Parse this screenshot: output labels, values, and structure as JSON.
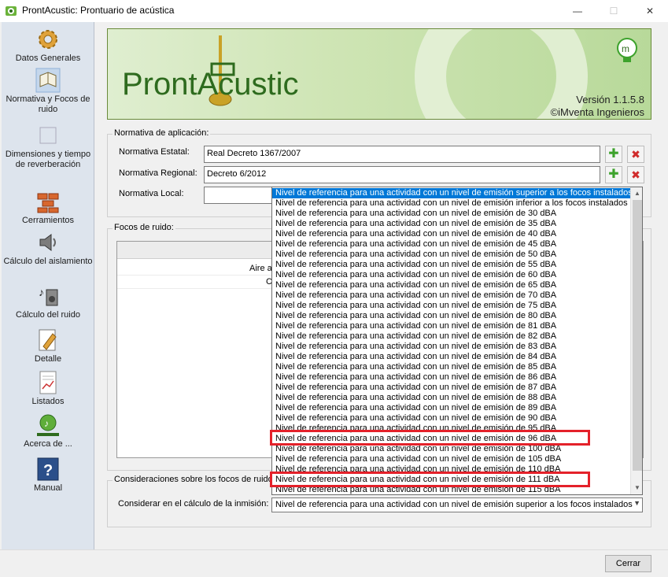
{
  "window": {
    "title": "ProntAcustic: Prontuario de acústica",
    "min_glyph": "—",
    "max_glyph": "☐",
    "close_glyph": "✕"
  },
  "sidebar": {
    "items": [
      {
        "label": "Datos Generales",
        "icon": "gear-icon"
      },
      {
        "label": "Normativa y Focos de ruido",
        "icon": "book-icon",
        "active": true
      },
      {
        "label": "Dimensiones y tiempo de reverberación",
        "icon": "dimensions-icon"
      },
      {
        "label": "Cerramientos",
        "icon": "bricks-icon"
      },
      {
        "label": "Cálculo del aislamiento",
        "icon": "speaker-off-icon"
      },
      {
        "label": "Cálculo del ruido",
        "icon": "music-speaker-icon"
      },
      {
        "label": "Detalle",
        "icon": "detail-icon"
      },
      {
        "label": "Listados",
        "icon": "list-icon"
      },
      {
        "label": "Acerca de ...",
        "icon": "about-icon"
      },
      {
        "label": "Manual",
        "icon": "help-icon"
      }
    ]
  },
  "banner": {
    "title": "ProntAcustic",
    "version": "Versión 1.1.5.8",
    "company": "©iMventa Ingenieros"
  },
  "normativa": {
    "group_title": "Normativa de aplicación:",
    "estatal_label": "Normativa Estatal:",
    "estatal_value": "Real Decreto 1367/2007",
    "regional_label": "Normativa Regional:",
    "regional_value": "Decreto 6/2012",
    "local_label": "Normativa Local:",
    "add_glyph": "✚",
    "delete_glyph": "✖"
  },
  "focos": {
    "group_title": "Focos de ruido:",
    "rows": [
      "Aire ac",
      "C"
    ]
  },
  "dropdown": {
    "items": [
      "Nivel de referencia para una actividad con un nivel de emisión superior a los focos instalados",
      "Nivel de referencia para una actividad con un nivel de emisión inferior a los focos instalados",
      "Nivel de referencia para una actividad con un nivel de emisión de 30 dBA",
      "Nivel de referencia para una actividad con un nivel de emisión de 35 dBA",
      "Nivel de referencia para una actividad con un nivel de emisión de 40 dBA",
      "Nivel de referencia para una actividad con un nivel de emisión de 45 dBA",
      "Nivel de referencia para una actividad con un nivel de emisión de 50 dBA",
      "Nivel de referencia para una actividad con un nivel de emisión de 55 dBA",
      "Nivel de referencia para una actividad con un nivel de emisión de 60 dBA",
      "Nivel de referencia para una actividad con un nivel de emisión de 65 dBA",
      "Nivel de referencia para una actividad con un nivel de emisión de 70 dBA",
      "Nivel de referencia para una actividad con un nivel de emisión de 75 dBA",
      "Nivel de referencia para una actividad con un nivel de emisión de 80 dBA",
      "Nivel de referencia para una actividad con un nivel de emisión de 81 dBA",
      "Nivel de referencia para una actividad con un nivel de emisión de 82 dBA",
      "Nivel de referencia para una actividad con un nivel de emisión de 83 dBA",
      "Nivel de referencia para una actividad con un nivel de emisión de 84 dBA",
      "Nivel de referencia para una actividad con un nivel de emisión de 85 dBA",
      "Nivel de referencia para una actividad con un nivel de emisión de 86 dBA",
      "Nivel de referencia para una actividad con un nivel de emisión de 87 dBA",
      "Nivel de referencia para una actividad con un nivel de emisión de 88 dBA",
      "Nivel de referencia para una actividad con un nivel de emisión de 89 dBA",
      "Nivel de referencia para una actividad con un nivel de emisión de 90 dBA",
      "Nivel de referencia para una actividad con un nivel de emisión de 95 dBA",
      "Nivel de referencia para una actividad con un nivel de emisión de 96 dBA",
      "Nivel de referencia para una actividad con un nivel de emisión de 100 dBA",
      "Nivel de referencia para una actividad con un nivel de emisión de 105 dBA",
      "Nivel de referencia para una actividad con un nivel de emisión de 110 dBA",
      "Nivel de referencia para una actividad con un nivel de emisión de 111 dBA",
      "Nivel de referencia para una actividad con un nivel de emisión de 115 dBA"
    ],
    "selected_index": 0,
    "highlighted_indices": [
      24,
      28
    ],
    "highlight_color": "#e4212a",
    "selection_color": "#0078d7"
  },
  "consideraciones": {
    "group_title": "Consideraciones sobre los focos de ruido:",
    "label": "Considerar en el cálculo de la inmisión:",
    "value": "Nivel de referencia para una actividad con un nivel de emisión superior a los focos instalados"
  },
  "footer": {
    "close_label": "Cerrar"
  }
}
